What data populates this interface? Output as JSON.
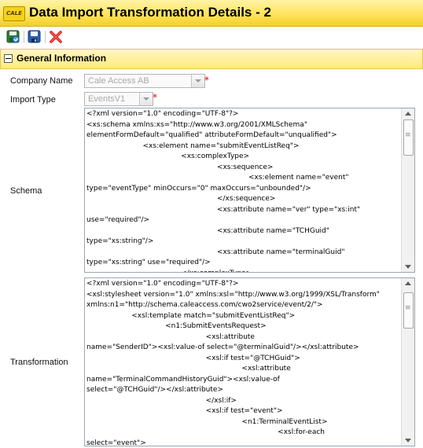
{
  "window": {
    "logo_text": "CALE",
    "title": "Data Import Transformation Details - 2"
  },
  "toolbar": {
    "buttons": [
      {
        "name": "save-and-close-icon"
      },
      {
        "name": "save-icon"
      },
      {
        "name": "delete-icon"
      }
    ]
  },
  "panel": {
    "title": "General Information"
  },
  "form": {
    "company_label": "Company Name",
    "company_value": "Cale Access AB",
    "import_type_label": "Import Type",
    "import_type_value": "EventsV1",
    "required_mark": "*",
    "schema_label": "Schema",
    "transformation_label": "Transformation",
    "schema_text": "<?xml version=\"1.0\" encoding=\"UTF-8\"?>\n<xs:schema xmlns:xs=\"http://www.w3.org/2001/XMLSchema\"\nelementFormDefault=\"qualified\" attributeFormDefault=\"unqualified\">\n                         <xs:element name=\"submitEventListReq\">\n                                          <xs:complexType>\n                                                          <xs:sequence>\n                                                                        <xs:element name=\"event\"\ntype=\"eventType\" minOccurs=\"0\" maxOccurs=\"unbounded\"/>\n                                                          </xs:sequence>\n                                                          <xs:attribute name=\"ver\" type=\"xs:int\"\nuse=\"required\"/>\n                                                          <xs:attribute name=\"TCHGuid\"\ntype=\"xs:string\"/>\n                                                          <xs:attribute name=\"terminalGuid\"\ntype=\"xs:string\" use=\"required\"/>\n                                          </xs:complexType>\n                         </xs:element>",
    "transformation_text": "<?xml version=\"1.0\" encoding=\"UTF-8\"?>\n<xsl:stylesheet version=\"1.0\" xmlns:xsl=\"http://www.w3.org/1999/XSL/Transform\"\nxmlns:n1=\"http://schema.caleaccess.com/cwo2service/event/2/\">\n                    <xsl:template match=\"submitEventListReq\">\n                                   <n1:SubmitEventsRequest>\n                                                     <xsl:attribute\nname=\"SenderID\"><xsl:value-of select=\"@terminalGuid\"/></xsl:attribute>\n                                                     <xsl:if test=\"@TCHGuid\">\n                                                                     <xsl:attribute\nname=\"TerminalCommandHistoryGuid\"><xsl:value-of\nselect=\"@TCHGuid\"/></xsl:attribute>\n                                                     </xsl:if>\n                                                     <xsl:if test=\"event\">\n                                                                     <n1:TerminalEventList>\n                                                                                     <xsl:for-each\nselect=\"event\">\n           <xsl:sort select=\"@timestamp\" order=\"ascending\"/>"
  }
}
